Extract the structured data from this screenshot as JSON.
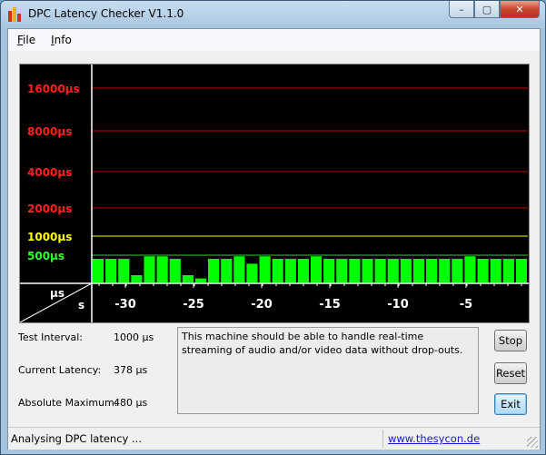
{
  "window": {
    "title": "DPC Latency Checker V1.1.0",
    "controls": {
      "minimize": "–",
      "maximize": "▢",
      "close": "✕"
    }
  },
  "menu": {
    "file": "File",
    "file_key": "F",
    "file_rest": "ile",
    "info": "Info",
    "info_key": "I",
    "info_rest": "nfo"
  },
  "chart_data": {
    "type": "bar",
    "y_labels": [
      {
        "text": "16000µs",
        "value": 16000,
        "color": "#ff2020"
      },
      {
        "text": "8000µs",
        "value": 8000,
        "color": "#ff2020"
      },
      {
        "text": "4000µs",
        "value": 4000,
        "color": "#ff2020"
      },
      {
        "text": "2000µs",
        "value": 2000,
        "color": "#ff2020"
      },
      {
        "text": "1000µs",
        "value": 1000,
        "color": "#ffff00"
      },
      {
        "text": "500µs",
        "value": 500,
        "color": "#33ff33"
      }
    ],
    "x_axis": {
      "corner_top": "µs",
      "corner_bottom": "s",
      "ticks": [
        "-30",
        "-25",
        "-20",
        "-15",
        "-10",
        "-5"
      ]
    },
    "values_us": [
      436,
      436,
      436,
      145,
      480,
      480,
      436,
      145,
      87,
      436,
      436,
      480,
      349,
      480,
      436,
      436,
      436,
      480,
      436,
      436,
      436,
      436,
      436,
      436,
      436,
      436,
      436,
      436,
      436,
      480,
      436,
      436,
      436,
      436
    ],
    "colors": {
      "bar": "#00ff00",
      "background": "#000000",
      "grid_red": "#c00000",
      "grid_yellow": "#ffff00",
      "grid_green": "#33cc33"
    }
  },
  "info": {
    "test_interval_label": "Test Interval:",
    "test_interval_value": "1000 µs",
    "current_latency_label": "Current Latency:",
    "current_latency_value": "378 µs",
    "absolute_maximum_label": "Absolute Maximum:",
    "absolute_maximum_value": "480 µs"
  },
  "message": "This machine should be able to handle real-time streaming of audio and/or video data without drop-outs.",
  "buttons": {
    "stop": "Stop",
    "reset": "Reset",
    "exit": "Exit"
  },
  "status": {
    "text": "Analysing DPC latency ...",
    "link": "www.thesycon.de"
  }
}
